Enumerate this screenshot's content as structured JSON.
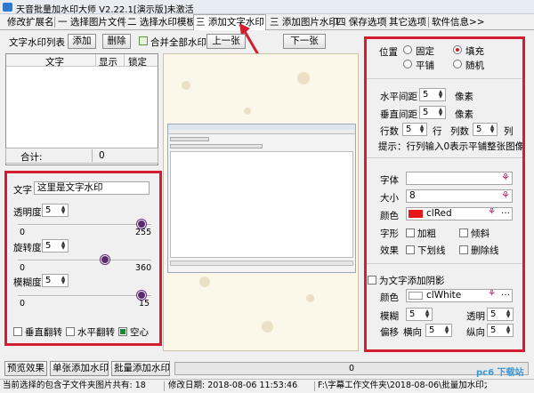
{
  "window": {
    "title": "天音批量加水印大师 V2.22.1[演示版]未激活"
  },
  "tabs": [
    {
      "label": "修改扩展名"
    },
    {
      "label": "一 选择图片文件"
    },
    {
      "label": "二 选择水印模板"
    },
    {
      "label": "三 添加文字水印"
    },
    {
      "label": "三 添加图片水印"
    },
    {
      "label": "四 保存选项"
    },
    {
      "label": "其它选项"
    },
    {
      "label": "软件信息>>"
    }
  ],
  "list": {
    "title": "文字水印列表",
    "add": "添加",
    "delete": "删除",
    "merge": "合并全部水印",
    "prev": "上一张",
    "next": "下一张",
    "col_text": "文字",
    "col_show": "显示",
    "col_lock": "锁定",
    "total_label": "合计:",
    "total_value": "0"
  },
  "text_panel": {
    "text_label": "文字",
    "text_value": "这里是文字水印",
    "opacity_label": "透明度",
    "opacity_value": "5",
    "opacity_min": "0",
    "opacity_max": "255",
    "rotate_label": "旋转度",
    "rotate_value": "5",
    "rotate_min": "0",
    "rotate_max": "360",
    "blur_label": "模糊度",
    "blur_value": "5",
    "blur_min": "0",
    "blur_max": "15",
    "vflip": "垂直翻转",
    "hflip": "水平翻转",
    "hollow": "空心"
  },
  "sliders": {
    "opacity": 1.0,
    "rotate": 0.78,
    "blur": 1.0
  },
  "right_panel": {
    "position_label": "位置",
    "pos_fixed": "固定",
    "pos_fill": "填充",
    "pos_tile": "平铺",
    "pos_random": "随机",
    "hspace_label": "水平间距",
    "hspace_value": "5",
    "hspace_unit": "像素",
    "vspace_label": "垂直间距",
    "vspace_value": "5",
    "vspace_unit": "像素",
    "rows_label": "行数",
    "rows_value": "5",
    "rows_unit": "行",
    "cols_label": "列数",
    "cols_value": "5",
    "cols_unit": "列",
    "hint": "提示：行列输入0表示平铺整张图像",
    "font_label": "字体",
    "font_value": "",
    "size_label": "大小",
    "size_value": "8",
    "color_label": "颜色",
    "color_value": "clRed",
    "style_label": "字形",
    "bold": "加粗",
    "italic": "倾斜",
    "effect_label": "效果",
    "underline": "下划线",
    "strike": "删除线",
    "shadow_label": "为文字添加阴影",
    "shadow_color_label": "颜色",
    "shadow_color_value": "clWhite",
    "shadow_blur_label": "模糊",
    "shadow_blur_value": "5",
    "shadow_alpha_label": "透明",
    "shadow_alpha_value": "5",
    "offset_label": "偏移",
    "offset_h_label": "横向",
    "offset_h_value": "5",
    "offset_v_label": "纵向",
    "offset_v_value": "5"
  },
  "colors": {
    "font": "#e81818",
    "shadow": "#ffffff",
    "highlight": "#d21e2e"
  },
  "bottom": {
    "preview": "预览效果",
    "single": "单张添加水印",
    "batch": "批量添加水印",
    "progress_value": "0"
  },
  "status": {
    "subfolders": "当前选择的包含子文件夹图片共有: 18",
    "modified": "修改日期: 2018-08-06 11:53:46",
    "path": "F:\\字幕工作文件夹\\2018-08-06\\批量加水印大师\\2018-08-06_115309.jpg",
    "watermark": "pc6 下载站"
  }
}
